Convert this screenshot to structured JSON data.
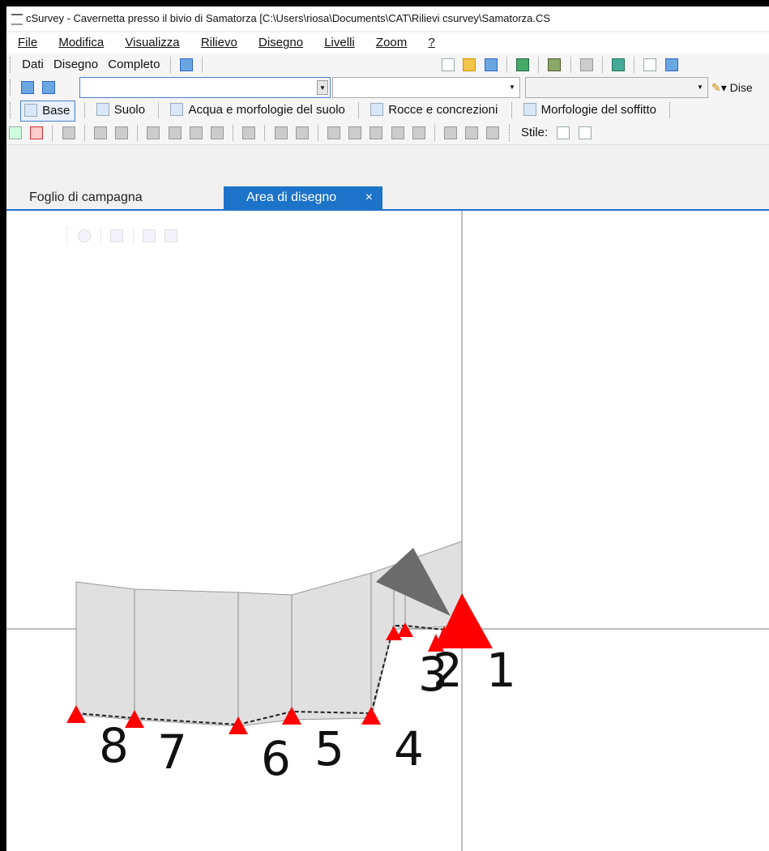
{
  "window": {
    "title": "cSurvey - Cavernetta presso il bivio di Samatorza [C:\\Users\\riosa\\Documents\\CAT\\Rilievi csurvey\\Samatorza.CS"
  },
  "menu": [
    "File",
    "Modifica",
    "Visualizza",
    "Rilievo",
    "Disegno",
    "Livelli",
    "Zoom",
    "?"
  ],
  "view_buttons": [
    "Dati",
    "Disegno",
    "Completo"
  ],
  "toolbar": {
    "design_label": "Dise",
    "style_label": "Stile:"
  },
  "layers": [
    {
      "label": "Base",
      "active": true
    },
    {
      "label": "Suolo",
      "active": false
    },
    {
      "label": "Acqua e morfologie del suolo",
      "active": false
    },
    {
      "label": "Rocce e concrezioni",
      "active": false
    },
    {
      "label": "Morfologie del soffitto",
      "active": false
    }
  ],
  "tabs": [
    {
      "label": "Foglio di campagna",
      "active": false
    },
    {
      "label": "Area di disegno",
      "active": true,
      "close_icon": "×"
    }
  ],
  "stations": [
    "1",
    "2",
    "3",
    "4",
    "5",
    "6",
    "7",
    "8"
  ],
  "colors": {
    "accent": "#1c73c8",
    "station_marker": "#ff0000",
    "passage_fill": "#e0e0e0",
    "north_arrow": "#6b6b6b"
  }
}
